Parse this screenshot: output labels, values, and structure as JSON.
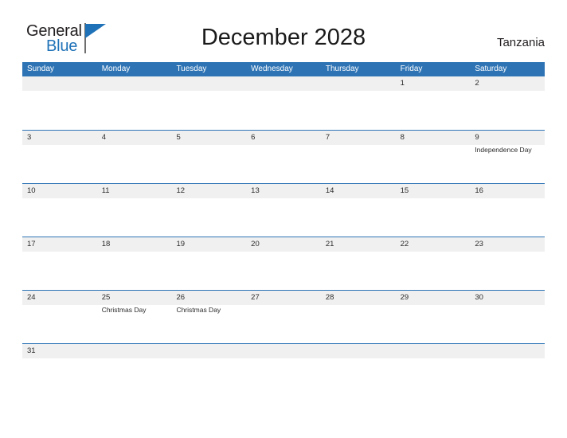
{
  "brand": {
    "name_part1": "General",
    "name_part2": "Blue",
    "color_dark": "#231f20",
    "color_blue": "#1f72b8"
  },
  "header": {
    "title": "December 2028",
    "country": "Tanzania"
  },
  "calendar": {
    "accent_color": "#2e74b5",
    "number_band_color": "#f0f0f0",
    "day_names": [
      "Sunday",
      "Monday",
      "Tuesday",
      "Wednesday",
      "Thursday",
      "Friday",
      "Saturday"
    ],
    "weeks": [
      {
        "days": [
          {
            "number": "",
            "events": []
          },
          {
            "number": "",
            "events": []
          },
          {
            "number": "",
            "events": []
          },
          {
            "number": "",
            "events": []
          },
          {
            "number": "",
            "events": []
          },
          {
            "number": "1",
            "events": []
          },
          {
            "number": "2",
            "events": []
          }
        ]
      },
      {
        "days": [
          {
            "number": "3",
            "events": []
          },
          {
            "number": "4",
            "events": []
          },
          {
            "number": "5",
            "events": []
          },
          {
            "number": "6",
            "events": []
          },
          {
            "number": "7",
            "events": []
          },
          {
            "number": "8",
            "events": []
          },
          {
            "number": "9",
            "events": [
              "Independence Day"
            ]
          }
        ]
      },
      {
        "days": [
          {
            "number": "10",
            "events": []
          },
          {
            "number": "11",
            "events": []
          },
          {
            "number": "12",
            "events": []
          },
          {
            "number": "13",
            "events": []
          },
          {
            "number": "14",
            "events": []
          },
          {
            "number": "15",
            "events": []
          },
          {
            "number": "16",
            "events": []
          }
        ]
      },
      {
        "days": [
          {
            "number": "17",
            "events": []
          },
          {
            "number": "18",
            "events": []
          },
          {
            "number": "19",
            "events": []
          },
          {
            "number": "20",
            "events": []
          },
          {
            "number": "21",
            "events": []
          },
          {
            "number": "22",
            "events": []
          },
          {
            "number": "23",
            "events": []
          }
        ]
      },
      {
        "days": [
          {
            "number": "24",
            "events": []
          },
          {
            "number": "25",
            "events": [
              "Christmas Day"
            ]
          },
          {
            "number": "26",
            "events": [
              "Christmas Day"
            ]
          },
          {
            "number": "27",
            "events": []
          },
          {
            "number": "28",
            "events": []
          },
          {
            "number": "29",
            "events": []
          },
          {
            "number": "30",
            "events": []
          }
        ]
      },
      {
        "short": true,
        "days": [
          {
            "number": "31",
            "events": []
          },
          {
            "number": "",
            "events": []
          },
          {
            "number": "",
            "events": []
          },
          {
            "number": "",
            "events": []
          },
          {
            "number": "",
            "events": []
          },
          {
            "number": "",
            "events": []
          },
          {
            "number": "",
            "events": []
          }
        ]
      }
    ]
  }
}
